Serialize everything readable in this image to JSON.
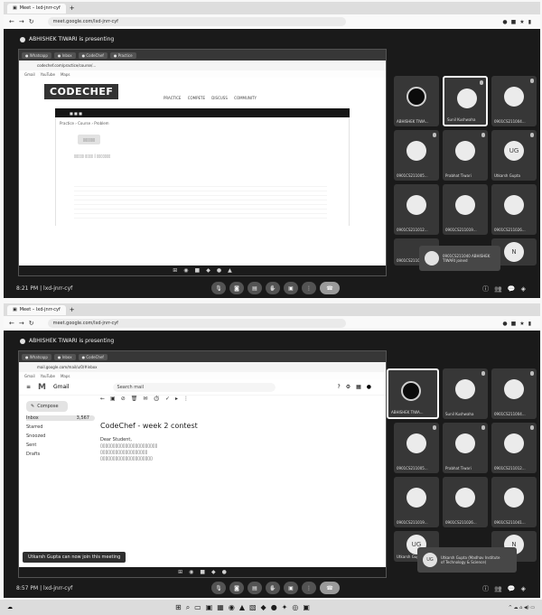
{
  "screens": [
    {
      "browser_url": "meet.google.com/lxd-jnrr-cyf",
      "presenting_text": "ABHISHEK TIWARI is presenting",
      "inner_url": "codechef.com/practice/course/...",
      "site_logo": "CODECHEF",
      "time": "8:21 PM",
      "meeting_code": "lxd-jnrr-cyf",
      "participants": [
        {
          "name": "ABHISHEK TIWA...",
          "initials": "",
          "highlight": false
        },
        {
          "name": "Sunil Kushwaha",
          "initials": "",
          "highlight": true
        },
        {
          "name": "0901CS211004...",
          "initials": "",
          "highlight": false
        },
        {
          "name": "0901CS211005...",
          "initials": "",
          "highlight": false
        },
        {
          "name": "Prabhat Tiwari",
          "initials": "",
          "highlight": false
        },
        {
          "name": "Utkarsh Gupta",
          "initials": "UG",
          "highlight": false
        },
        {
          "name": "0901CS211012...",
          "initials": "",
          "highlight": false
        },
        {
          "name": "0901CS211019...",
          "initials": "",
          "highlight": false
        },
        {
          "name": "0901CS211026...",
          "initials": "",
          "highlight": false
        },
        {
          "name": "0901CS211041...",
          "initials": "",
          "highlight": false
        },
        {
          "name": "",
          "initials": "",
          "highlight": false
        },
        {
          "name": "",
          "initials": "N",
          "highlight": false
        }
      ],
      "self_tile": {
        "line1": "0901CS211040 ABHISHEK",
        "line2": "TIWARI joined"
      }
    },
    {
      "browser_url": "meet.google.com/lxd-jnrr-cyf",
      "presenting_text": "ABHISHEK TIWARI is presenting",
      "inner_url": "mail.google.com/mail/u/0/#inbox",
      "gmail_label": "Gmail",
      "search_placeholder": "Search mail",
      "compose_label": "Compose",
      "nav": [
        {
          "label": "Inbox",
          "count": "3,567",
          "active": true
        },
        {
          "label": "Starred",
          "count": "",
          "active": false
        },
        {
          "label": "Snoozed",
          "count": "",
          "active": false
        },
        {
          "label": "Sent",
          "count": "",
          "active": false
        },
        {
          "label": "Drafts",
          "count": "",
          "active": false
        }
      ],
      "email_subject": "CodeChef - week 2 contest",
      "email_greeting": "Dear Student,",
      "toast": "Utkarsh Gupta can now join this meeting",
      "time": "8:57 PM",
      "meeting_code": "lxd-jnrr-cyf",
      "participants": [
        {
          "name": "ABHISHEK TIWA...",
          "initials": "",
          "highlight": true
        },
        {
          "name": "Sunil Kushwaha",
          "initials": "",
          "highlight": false
        },
        {
          "name": "0901CS211004...",
          "initials": "",
          "highlight": false
        },
        {
          "name": "0901CS211005...",
          "initials": "",
          "highlight": false
        },
        {
          "name": "Prabhat Tiwari",
          "initials": "",
          "highlight": false
        },
        {
          "name": "0901CS211012...",
          "initials": "",
          "highlight": false
        },
        {
          "name": "0901CS211019...",
          "initials": "",
          "highlight": false
        },
        {
          "name": "0901CS211026...",
          "initials": "",
          "highlight": false
        },
        {
          "name": "0901CS211041...",
          "initials": "",
          "highlight": false
        },
        {
          "name": "Utkarsh Gupta",
          "initials": "UG",
          "highlight": false
        },
        {
          "name": "",
          "initials": "",
          "highlight": false
        },
        {
          "name": "",
          "initials": "N",
          "highlight": false
        }
      ],
      "self_tile": {
        "line1": "Utkarsh Gupta (Madhav Institute",
        "line2": "of Technology & Science)"
      }
    }
  ]
}
